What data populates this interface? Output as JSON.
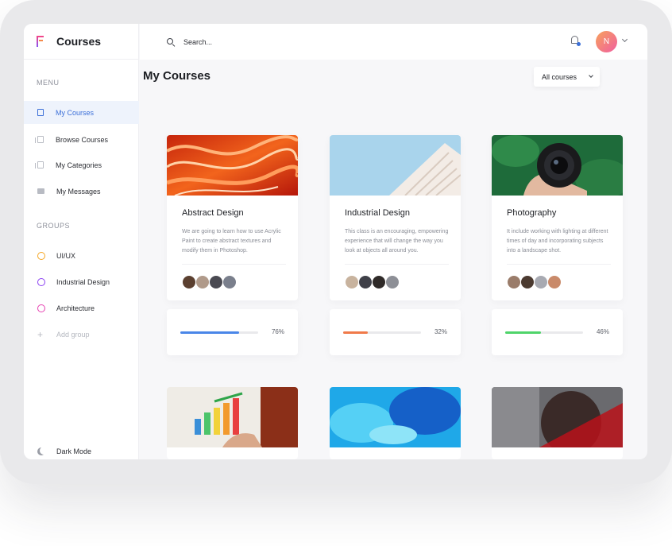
{
  "app": {
    "title": "Courses"
  },
  "sidebar": {
    "menu_title": "MENU",
    "menu": [
      {
        "label": "My Courses",
        "icon": "book-icon",
        "active": true
      },
      {
        "label": "Browse Courses",
        "icon": "stack-icon",
        "active": false
      },
      {
        "label": "My Categories",
        "icon": "stack-icon",
        "active": false
      },
      {
        "label": "My Messages",
        "icon": "mail-icon",
        "active": false
      }
    ],
    "groups_title": "GROUPS",
    "groups": [
      {
        "label": "UI/UX",
        "color": "#f5a623"
      },
      {
        "label": "Industrial Design",
        "color": "#8a3ff2"
      },
      {
        "label": "Architecture",
        "color": "#e63fb0"
      }
    ],
    "add_group": "Add group",
    "dark_mode": "Dark Mode"
  },
  "topbar": {
    "search_placeholder": "Search...",
    "avatar_initial": "N",
    "notification_icon": "bell-icon"
  },
  "main": {
    "title": "My Courses",
    "filter": "All courses",
    "courses": [
      {
        "title": "Abstract Design",
        "description": "We are going to learn how to use Acrylic Paint to create abstract textures and modify them in Photoshop.",
        "progress": 76,
        "progress_text": "76%",
        "progress_color": "#4a86e8"
      },
      {
        "title": "Industrial Design",
        "description": "This class is an encouraging, empowering experience that will change the way you look at objects all around you.",
        "progress": 32,
        "progress_text": "32%",
        "progress_color": "#f07a4a"
      },
      {
        "title": "Photography",
        "description": "It include working with lighting at different times of day  and incorporating subjects into a landscape shot.",
        "progress": 46,
        "progress_text": "46%",
        "progress_color": "#4fd46a"
      }
    ]
  }
}
